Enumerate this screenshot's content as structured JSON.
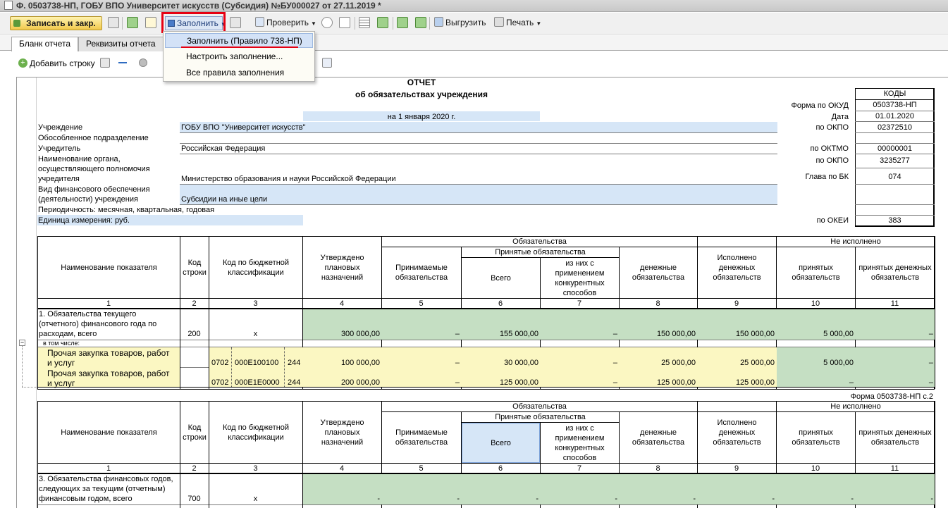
{
  "window": {
    "title": "Ф. 0503738-НП, ГОБУ ВПО Университет искусств (Субсидия) №БУ000027 от 27.11.2019 *"
  },
  "toolbar": {
    "save_close": "Записать и закр.",
    "fill": "Заполнить",
    "check": "Проверить",
    "export": "Выгрузить",
    "print": "Печать"
  },
  "fill_menu": {
    "items": [
      "Заполнить (Правило 738-НП)",
      "Настроить заполнение...",
      "Все правила заполнения"
    ]
  },
  "tabs": [
    "Бланк отчета",
    "Реквизиты отчета"
  ],
  "subbar": {
    "add_row": "Добавить строку"
  },
  "report": {
    "title": "ОТЧЕТ",
    "subtitle": "об обязательствах учреждения",
    "date_line": "на 1 января 2020 г.",
    "labels": {
      "institution": "Учреждение",
      "subdivision": "Обособленное подразделение",
      "founder": "Учредитель",
      "organ1": "Наименование органа,",
      "organ2": "осуществляющего полномочия",
      "organ3": "учредителя",
      "fin1": "Вид финансового обеспечения",
      "fin2": "(деятельности) учреждения",
      "period": "Периодичность: месячная, квартальная, годовая",
      "unit": "Единица измерения: руб."
    },
    "values": {
      "institution": "ГОБУ ВПО \"Университет искусств\"",
      "founder": "Российская Федерация",
      "organ": "Министерство образования и науки Российской Федерации",
      "fin": "Субсидии на иные цели"
    },
    "codes": {
      "header": "КОДЫ",
      "okud_label": "Форма по ОКУД",
      "okud": "0503738-НП",
      "date_label": "Дата",
      "date": "01.01.2020",
      "okpo_label": "по ОКПО",
      "okpo": "02372510",
      "oktmo_label": "по ОКТМО",
      "oktmo": "00000001",
      "okpo2_label": "по ОКПО",
      "okpo2": "3235277",
      "bk_label": "Глава по БК",
      "bk": "074",
      "okei_label": "по ОКЕИ",
      "okei": "383"
    },
    "headers": {
      "name": "Наименование показателя",
      "code": "Код строки",
      "kbk": "Код по бюджетной классификации",
      "approved": "Утверждено плановых назначений",
      "obligations": "Обязательства",
      "accepted_group": "Принятые обязательства",
      "accepting": "Принимаемые обязательства",
      "total": "Всего",
      "competitive": "из них с применением конкурентных способов",
      "monetary": "денежные обязательства",
      "executed": "Исполнено денежных обязательств",
      "not_executed": "Не исполнено",
      "ne_accepted": "принятых обязательств",
      "ne_monetary": "принятых денежных обязательств"
    },
    "col_numbers": [
      "1",
      "2",
      "3",
      "4",
      "5",
      "6",
      "7",
      "8",
      "9",
      "10",
      "11"
    ],
    "row200": {
      "name1": "1. Обязательства текущего",
      "name2": "(отчетного) финансового года по",
      "name3": "расходам, всего",
      "code": "200",
      "kbk": "x",
      "approved": "300 000,00",
      "accepting": "–",
      "total": "155 000,00",
      "competitive": "–",
      "monetary": "150 000,00",
      "executed": "150 000,00",
      "ne_accepted": "5 000,00",
      "ne_monetary": "–",
      "including": "в том числе:"
    },
    "sub1": {
      "name1": "Прочая закупка товаров, работ",
      "name2": "и услуг",
      "k1": "0702",
      "k2": "000Е100100",
      "k3": "244",
      "approved": "100 000,00",
      "accepting": "–",
      "total": "30 000,00",
      "competitive": "–",
      "monetary": "25 000,00",
      "executed": "25 000,00",
      "ne_accepted": "5 000,00",
      "ne_monetary": "–"
    },
    "sub2": {
      "name1": "Прочая закупка товаров, работ",
      "name2": "и услуг",
      "k1": "0702",
      "k2": "000Е1Е0000",
      "k3": "244",
      "approved": "200 000,00",
      "accepting": "–",
      "total": "125 000,00",
      "competitive": "–",
      "monetary": "125 000,00",
      "executed": "125 000,00",
      "ne_accepted": "–",
      "ne_monetary": "–"
    },
    "page2_label": "Форма 0503738-НП с.2",
    "row700": {
      "name1": "3. Обязательства финансовых годов,",
      "name2": "следующих за текущим (отчетным)",
      "name3": "финансовым годом, всего",
      "code": "700",
      "kbk": "x",
      "d": "-"
    }
  }
}
